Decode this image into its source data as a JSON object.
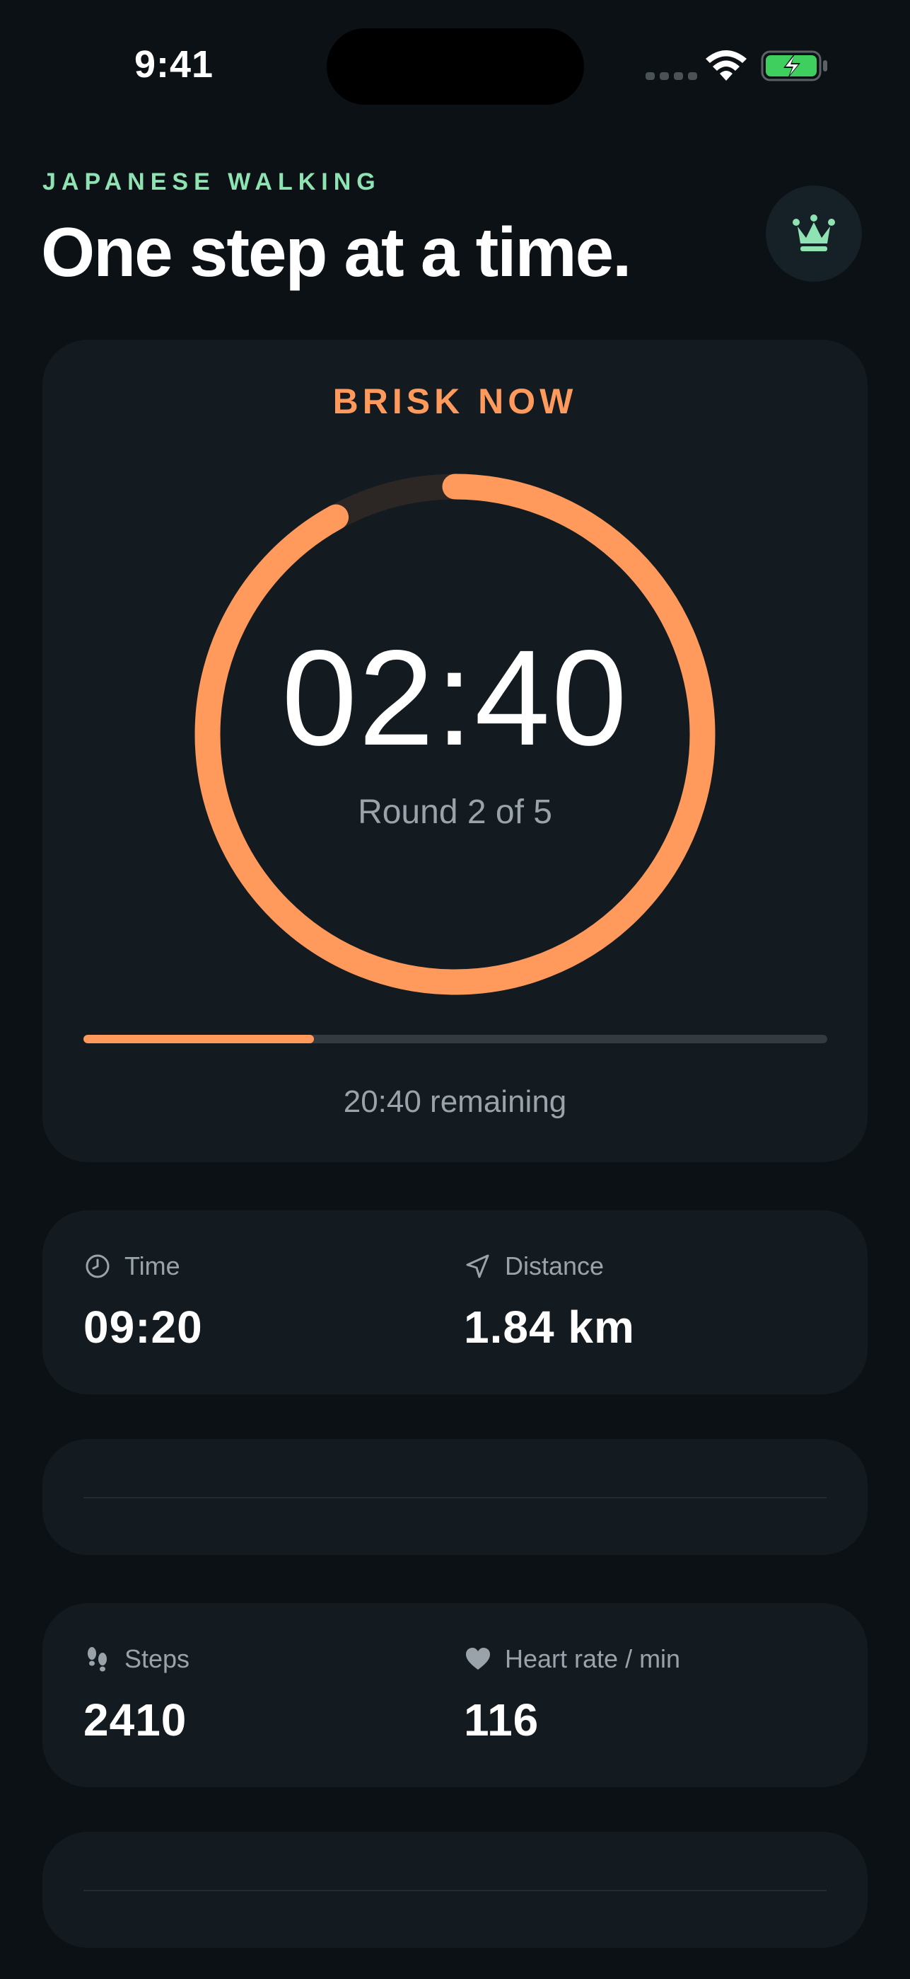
{
  "status_bar": {
    "time": "9:41",
    "icons": [
      "signal-dots-icon",
      "wifi-icon",
      "battery-charging-icon"
    ]
  },
  "header": {
    "eyebrow": "JAPANESE WALKING",
    "title": "One step at a time.",
    "premium_icon": "crown-icon"
  },
  "timer": {
    "phase": "BRISK NOW",
    "time": "02:40",
    "round": "Round 2 of 5",
    "ring_progress": 0.92,
    "session_progress": 0.31,
    "remaining": "20:40 remaining"
  },
  "stats_1": {
    "time_label": "Time",
    "time_value": "09:20",
    "time_icon": "clock-icon",
    "distance_label": "Distance",
    "distance_value": "1.84 km",
    "distance_icon": "location-arrow-icon"
  },
  "stats_2": {
    "steps_label": "Steps",
    "steps_value": "2410",
    "steps_icon": "footprints-icon",
    "heart_label": "Heart rate / min",
    "heart_value": "116",
    "heart_icon": "heart-icon"
  },
  "colors": {
    "background": "#0b1115",
    "card": "#131b20",
    "accent_orange": "#ff9a5c",
    "accent_green": "#8fe3b3",
    "battery_green": "#3fcf5e",
    "muted_text": "#9aa3a9"
  }
}
